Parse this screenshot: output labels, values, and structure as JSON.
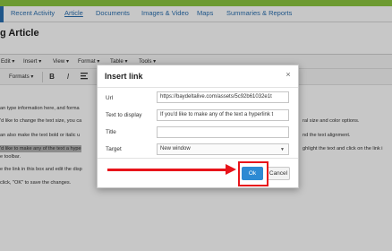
{
  "nav": {
    "tabs": [
      {
        "label": "Recent Activity"
      },
      {
        "label": "Article"
      },
      {
        "label": "Documents"
      },
      {
        "label": "Images & Video"
      },
      {
        "label": "Maps"
      },
      {
        "label": "Summaries & Reports"
      }
    ],
    "active_tab": "Article"
  },
  "page": {
    "title": "g Article"
  },
  "editor": {
    "menus": [
      "Edit ▾",
      "Insert ▾",
      "View ▾",
      "Format ▾",
      "Table ▾",
      "Tools ▾"
    ],
    "formats_label": "Formats ▾",
    "bold": "B",
    "italic": "I",
    "lines": [
      "an type information here, and forma",
      "'d like to change the text size, you ca",
      "an also make the text bold or italic u",
      "'d like to make any of the text a hype",
      "e toolbar.",
      "e the link in this box and edit the disp",
      "click, \"OK\" to save the changes."
    ],
    "right_fragments": [
      "ral size and color options.",
      "nd the text alignment.",
      "ghlight the text and click on the link i"
    ]
  },
  "dialog": {
    "title": "Insert link",
    "close": "×",
    "fields": {
      "url": {
        "label": "Url",
        "value": "https://baydeltalive.com/assets/5c92b61032e1t"
      },
      "text": {
        "label": "Text to display",
        "value": "If you'd like to make any of the text a hyperlink t"
      },
      "title": {
        "label": "Title",
        "value": ""
      },
      "target": {
        "label": "Target",
        "value": "New window"
      }
    },
    "ok_label": "Ok",
    "cancel_label": "Cancel"
  },
  "colors": {
    "accent_green": "#8cc63f",
    "link_blue": "#2a6fb0",
    "ok_blue": "#2d8ad3",
    "annotation_red": "#e8141b"
  }
}
